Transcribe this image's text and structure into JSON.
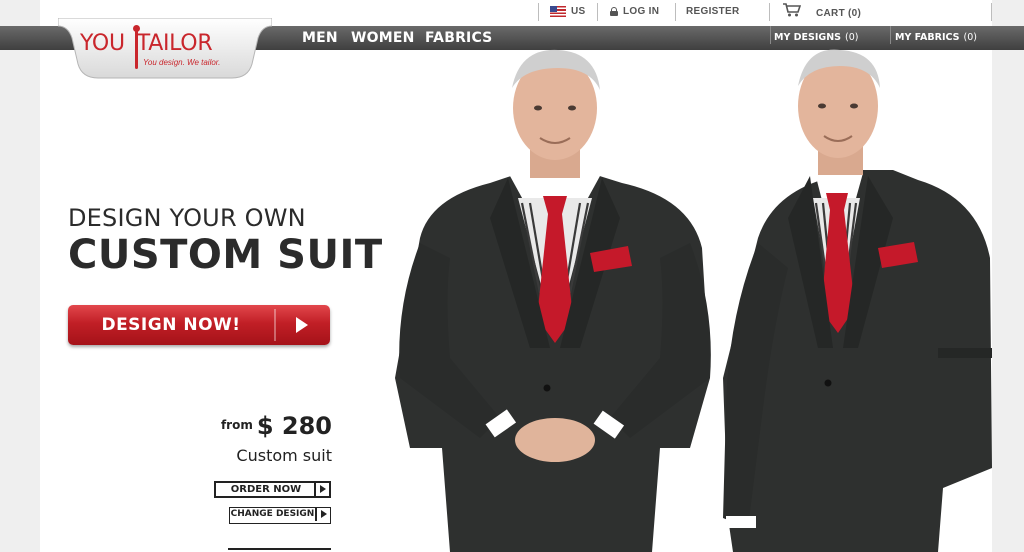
{
  "utility": {
    "region": "US",
    "login": "LOG IN",
    "register": "REGISTER",
    "cart": "CART (0)"
  },
  "logo": {
    "word1": "YOU",
    "word2": "TAILOR",
    "tagline": "You design. We tailor."
  },
  "nav": {
    "items": [
      "MEN",
      "WOMEN",
      "FABRICS"
    ],
    "my_designs": {
      "label": "MY DESIGNS",
      "count": "(0)"
    },
    "my_fabrics": {
      "label": "MY FABRICS",
      "count": "(0)"
    }
  },
  "hero": {
    "line1": "DESIGN YOUR OWN",
    "line2": "CUSTOM SUIT",
    "cta": "DESIGN NOW!",
    "price_from": "from",
    "price": "$ 280",
    "price_caption": "Custom suit",
    "order_now": "ORDER NOW",
    "change_design": "CHANGE DESIGN"
  },
  "colors": {
    "brand_red": "#c9262c",
    "nav_dark": "#4a4a4a",
    "suit": "#2e302f",
    "tie": "#c5192a"
  }
}
